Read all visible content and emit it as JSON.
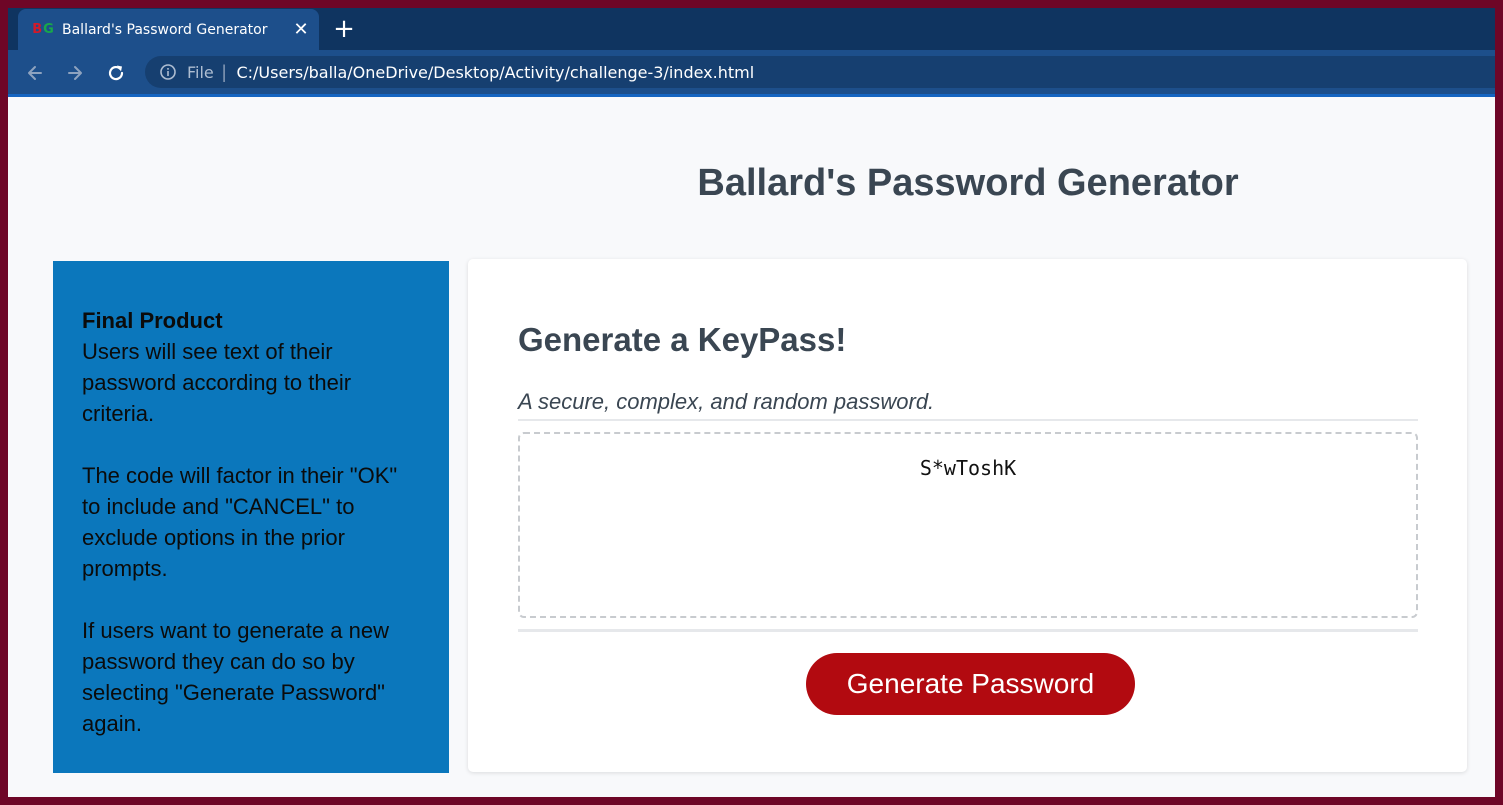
{
  "browser": {
    "tab_title": "Ballard's Password Generator",
    "tab_close": "✕",
    "new_tab": "+",
    "url_scheme": "File",
    "url_separator": "|",
    "url": "C:/Users/balla/OneDrive/Desktop/Activity/challenge-3/index.html",
    "favicon_letters": [
      "B",
      "G"
    ],
    "favicon_colors": [
      "#d11a2a",
      "#18a84a"
    ]
  },
  "page": {
    "title": "Ballard's Password Generator"
  },
  "sidebar": {
    "heading": "Final Product",
    "paragraph_1": "Users will see text of their password according to their criteria.",
    "paragraph_2": "The code will factor in their \"OK\" to include and \"CANCEL\" to exclude options in the prior prompts.",
    "paragraph_3": "If users want to generate a new password they can do so by selecting \"Generate Password\" again."
  },
  "card": {
    "header": "Generate a KeyPass!",
    "subtitle": "A secure, complex, and random password.",
    "password_value": "S*wToshK",
    "button_label": "Generate Password"
  },
  "colors": {
    "tabbar": "#0f3460",
    "toolbar": "#1d4f8b",
    "sidebar": "#0b77bc",
    "button": "#b20a10",
    "outer_frame": "#6e0627"
  }
}
